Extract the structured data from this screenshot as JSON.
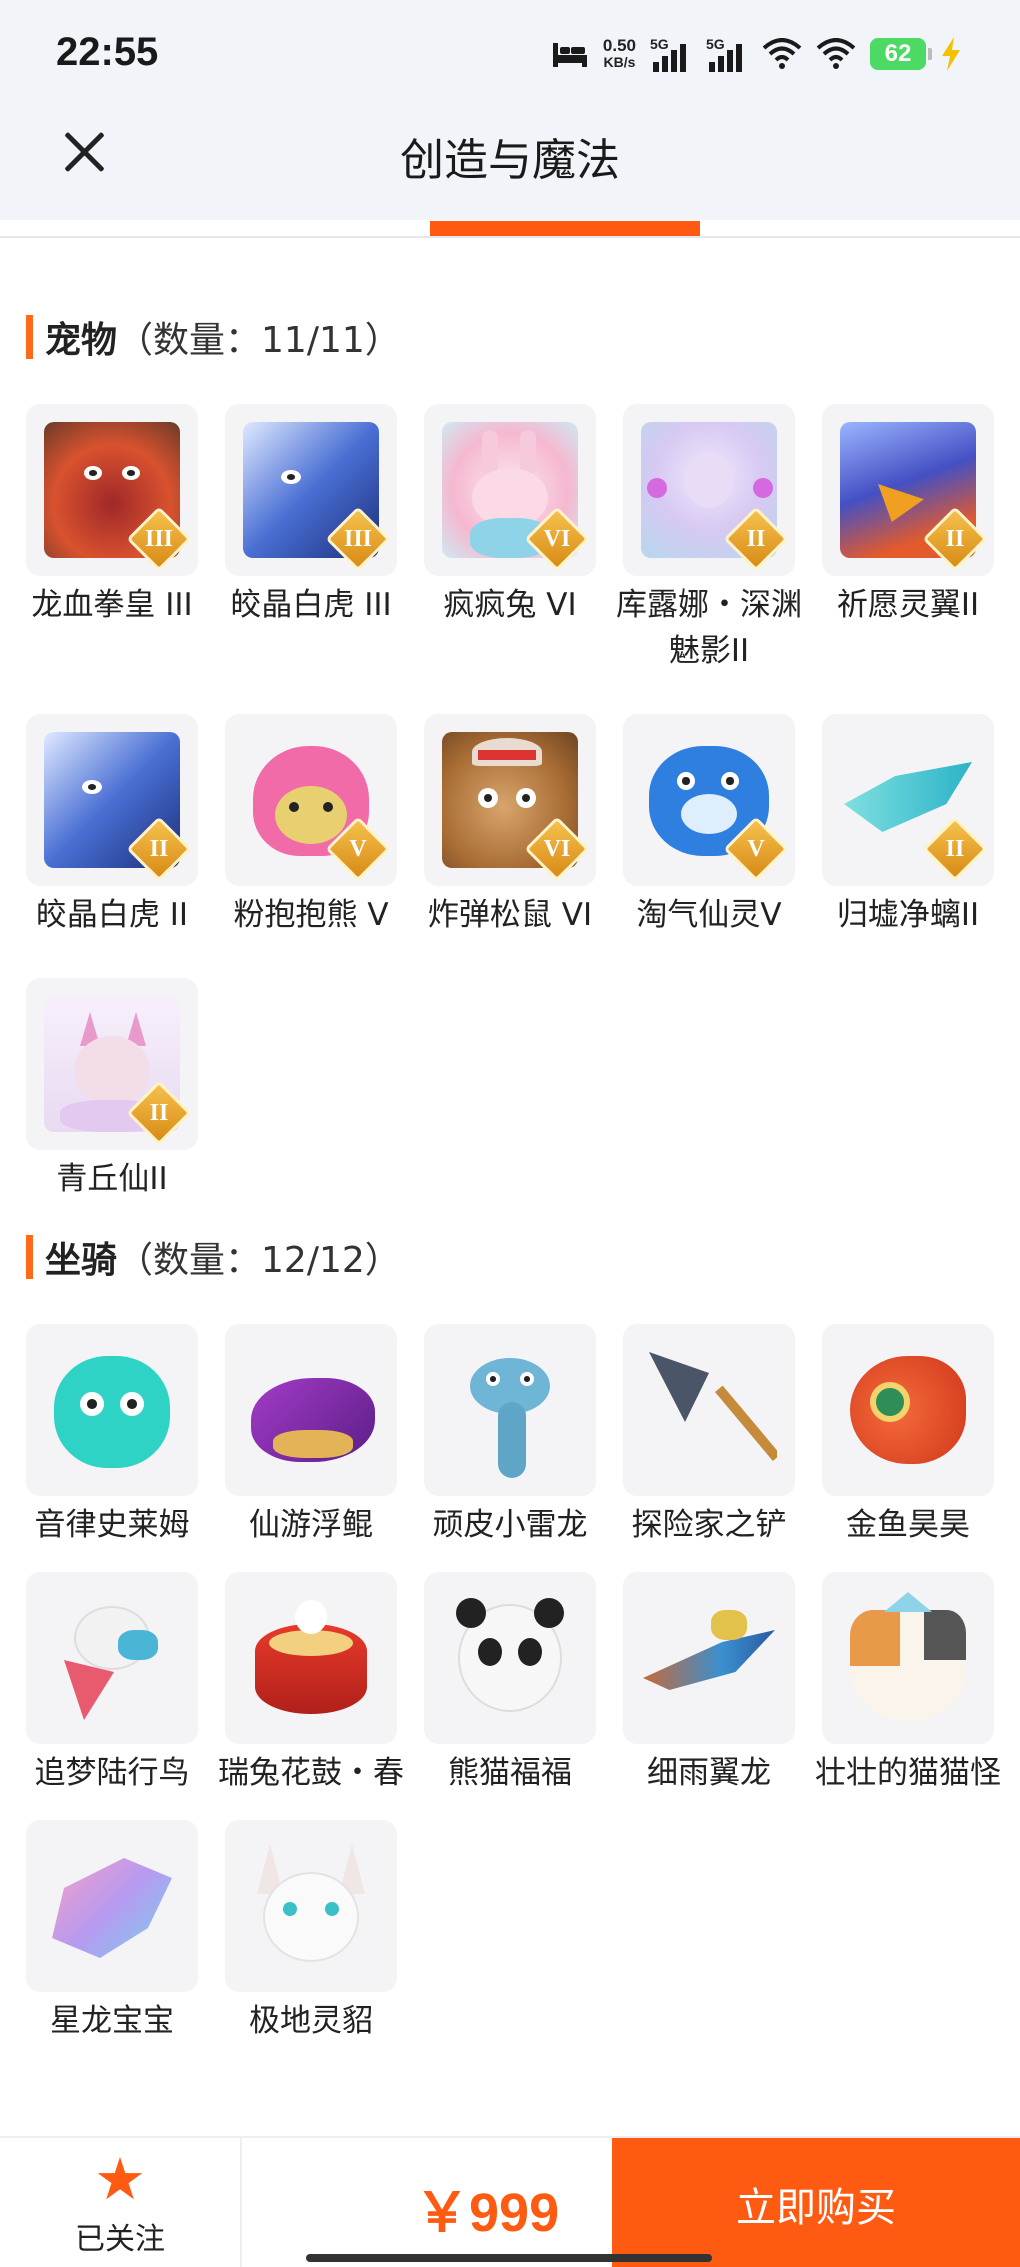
{
  "status_bar": {
    "time": "22:55",
    "net_speed_value": "0.50",
    "net_speed_unit": "KB/s",
    "sim1": "5G",
    "sim2": "5G",
    "battery": "62"
  },
  "header": {
    "title": "创造与魔法"
  },
  "pets": {
    "name": "宠物",
    "count": "（数量：11/11）",
    "items": [
      {
        "label": "龙血拳皇 III",
        "rank": "III",
        "art": "red"
      },
      {
        "label": "皎晶白虎 III",
        "rank": "III",
        "art": "blue"
      },
      {
        "label": "疯疯兔 VI",
        "rank": "VI",
        "art": "pink"
      },
      {
        "label": "库露娜・深渊魅影II",
        "rank": "II",
        "art": "lavender"
      },
      {
        "label": "祈愿灵翼II",
        "rank": "II",
        "art": "bird"
      },
      {
        "label": "皎晶白虎 II",
        "rank": "II",
        "art": "blue"
      },
      {
        "label": "粉抱抱熊 V",
        "rank": "V",
        "art": "pinkbear"
      },
      {
        "label": "炸弹松鼠 VI",
        "rank": "VI",
        "art": "brown"
      },
      {
        "label": "淘气仙灵V",
        "rank": "V",
        "art": "bluedog"
      },
      {
        "label": "归墟净螭II",
        "rank": "II",
        "art": "teal"
      },
      {
        "label": "青丘仙II",
        "rank": "II",
        "art": "fox"
      }
    ]
  },
  "mounts": {
    "name": "坐骑",
    "count": "（数量：12/12）",
    "items": [
      {
        "label": "音律史莱姆",
        "art": "slime"
      },
      {
        "label": "仙游浮鲲",
        "art": "purplefish"
      },
      {
        "label": "顽皮小雷龙",
        "art": "dragon"
      },
      {
        "label": "探险家之铲",
        "art": "shovel"
      },
      {
        "label": "金鱼昊昊",
        "art": "goldfish"
      },
      {
        "label": "追梦陆行鸟",
        "art": "whitebird"
      },
      {
        "label": "瑞兔花鼓・春",
        "art": "drum"
      },
      {
        "label": "熊猫福福",
        "art": "panda"
      },
      {
        "label": "细雨翼龙",
        "art": "pterosaur"
      },
      {
        "label": "壮壮的猫猫怪",
        "art": "cat"
      },
      {
        "label": "星龙宝宝",
        "art": "stardragon"
      },
      {
        "label": "极地灵貂",
        "art": "whitefox"
      }
    ]
  },
  "bottom_bar": {
    "follow_label": "已关注",
    "price": "￥999",
    "buy_label": "立即购买"
  },
  "colors": {
    "accent": "#ff5a12",
    "header_bg": "#f1f4f8",
    "rank_gold": "#e6a22a"
  }
}
